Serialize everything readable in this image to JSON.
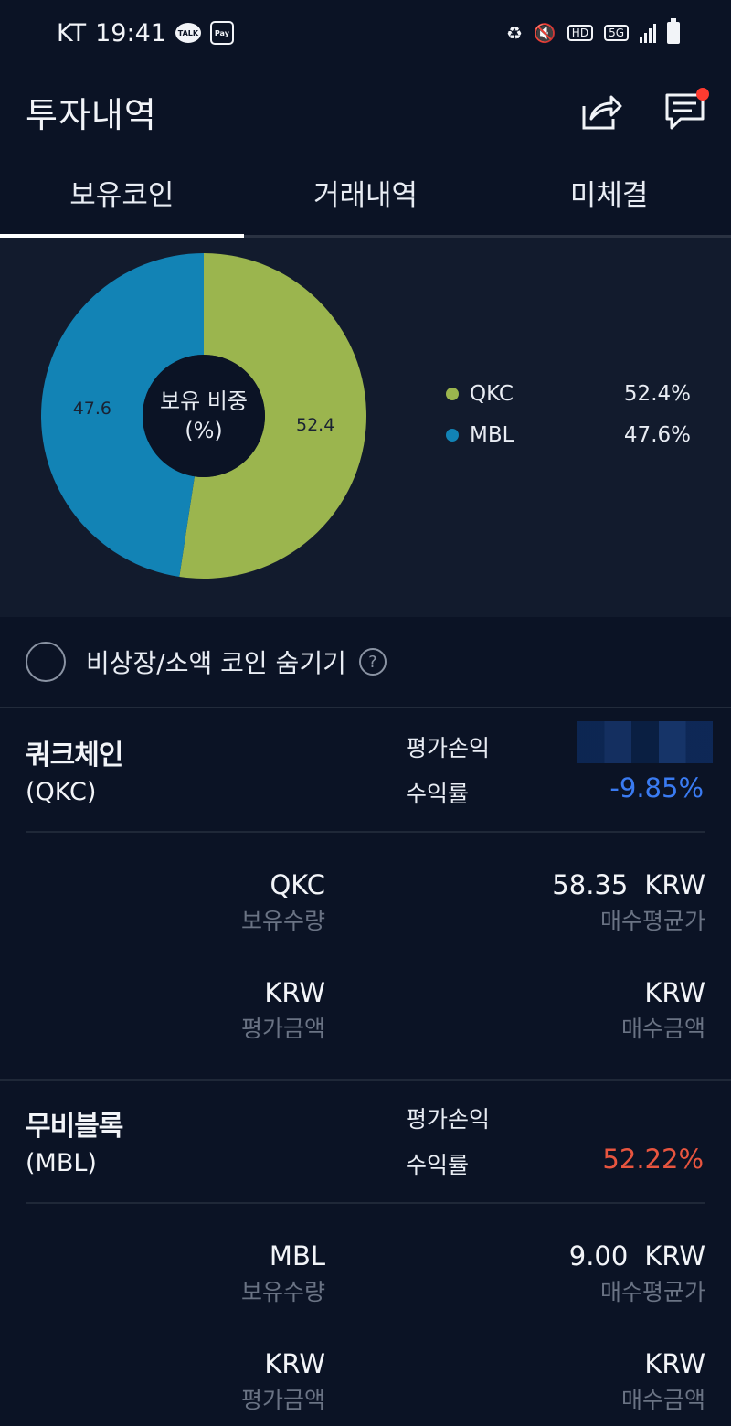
{
  "status": {
    "carrier": "KT",
    "time": "19:41",
    "talk": "TALK",
    "pay": "Pay",
    "hd": "HD",
    "network": "5G"
  },
  "header": {
    "title": "투자내역"
  },
  "tabs": [
    {
      "label": "보유코인",
      "active": true
    },
    {
      "label": "거래내역",
      "active": false
    },
    {
      "label": "미체결",
      "active": false
    }
  ],
  "chart_data": {
    "type": "pie",
    "title": "보유 비중 (%)",
    "center_label_line1": "보유 비중",
    "center_label_line2": "(%)",
    "categories": [
      "QKC",
      "MBL"
    ],
    "values": [
      52.4,
      47.6
    ],
    "slice_labels": [
      "52.4",
      "47.6"
    ],
    "colors": [
      "#9bb54e",
      "#1283b5"
    ],
    "legend": [
      {
        "name": "QKC",
        "pct": "52.4%",
        "color": "#9bb54e"
      },
      {
        "name": "MBL",
        "pct": "47.6%",
        "color": "#1283b5"
      }
    ],
    "legend_position": "right"
  },
  "filter": {
    "hide_label": "비상장/소액 코인 숨기기",
    "help": "?"
  },
  "labels": {
    "pnl": "평가손익",
    "rate": "수익률",
    "qty": "보유수량",
    "avg_price": "매수평균가",
    "eval_amount": "평가금액",
    "buy_amount": "매수금액",
    "krw": "KRW"
  },
  "coins": [
    {
      "name": "쿼크체인",
      "symbol": "(QKC)",
      "rate": "-9.85%",
      "rate_color": "#3a7bf2",
      "qty_unit": "QKC",
      "avg_price": "58.35",
      "avg_unit": "KRW",
      "eval_unit": "KRW",
      "buy_unit": "KRW"
    },
    {
      "name": "무비블록",
      "symbol": "(MBL)",
      "rate": "52.22%",
      "rate_color": "#e8553f",
      "qty_unit": "MBL",
      "avg_price": "9.00",
      "avg_unit": "KRW",
      "eval_unit": "KRW",
      "buy_unit": "KRW"
    }
  ]
}
